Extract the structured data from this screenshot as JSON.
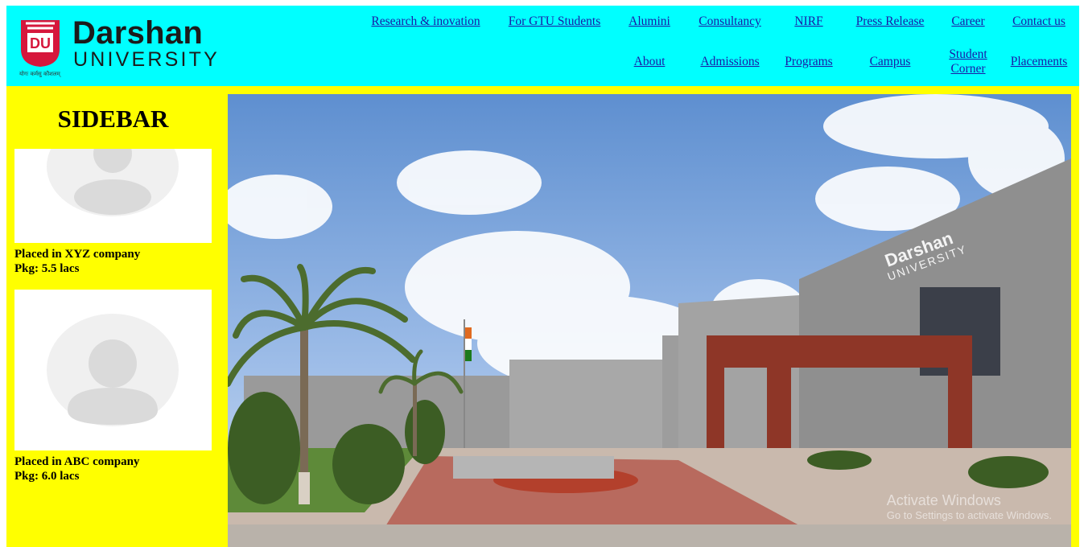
{
  "brand": {
    "name": "Darshan",
    "sub": "UNIVERSITY",
    "tagline": "योगः कर्मसु कौशलम्",
    "mark": "DU",
    "colors": {
      "header_bg": "#00ffff",
      "body_bg": "#ffff00",
      "logo_red": "#d6173c",
      "link": "#1a1aa6"
    }
  },
  "nav": {
    "research": "Research & inovation",
    "gtu": "For GTU Students",
    "alumni": "Alumini",
    "consultancy": "Consultancy",
    "nirf": "NIRF",
    "press": "Press Release",
    "career": "Career",
    "contact": "Contact us",
    "about": "About",
    "admissions": "Admissions",
    "programs": "Programs",
    "campus": "Campus",
    "student_corner": "Student Corner",
    "placements": "Placements"
  },
  "sidebar": {
    "title": "SIDEBAR",
    "cards": [
      {
        "company": "Placed in XYZ company",
        "pkg": "Pkg: 5.5 lacs",
        "icon": "avatar-placeholder-icon"
      },
      {
        "company": "Placed in ABC company",
        "pkg": "Pkg: 6.0 lacs",
        "icon": "avatar-placeholder-icon"
      }
    ]
  },
  "hero": {
    "building_sign": "Darshan",
    "building_sign_sub": "UNIVERSITY",
    "os_watermark_1": "Activate Windows",
    "os_watermark_2": "Go to Settings to activate Windows."
  }
}
